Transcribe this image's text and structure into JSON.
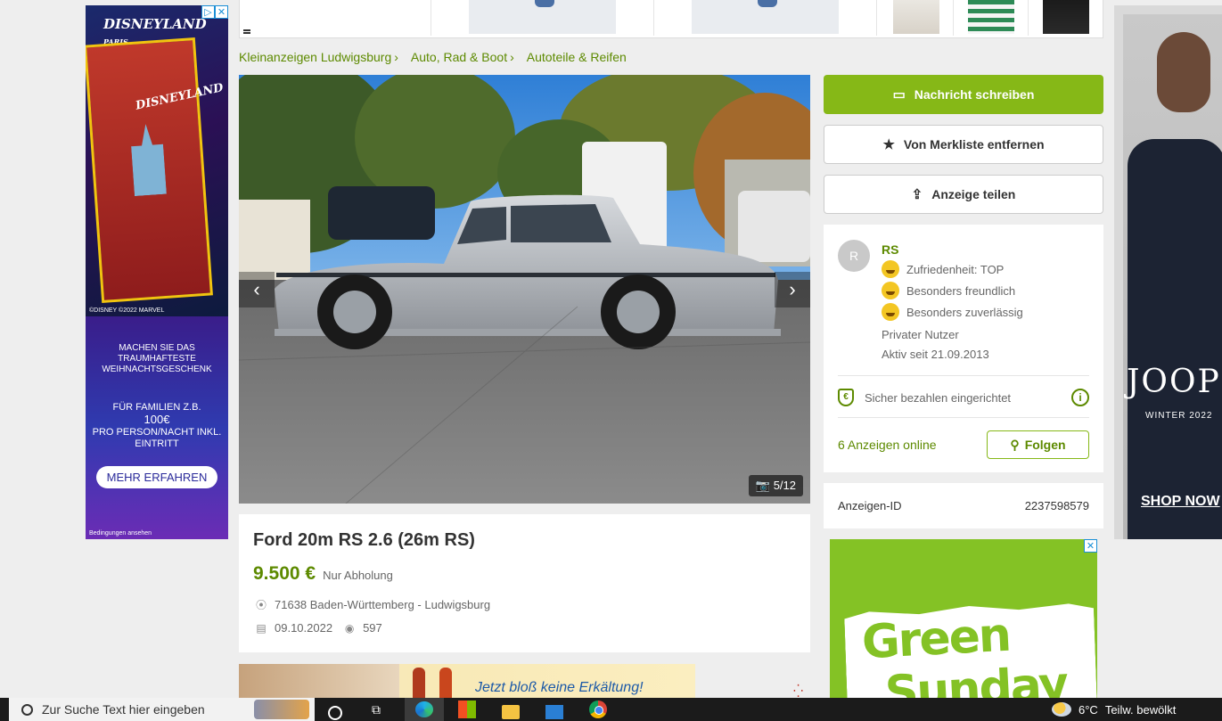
{
  "breadcrumb": [
    {
      "label": "Kleinanzeigen Ludwigsburg"
    },
    {
      "label": "Auto, Rad & Boot"
    },
    {
      "label": "Autoteile & Reifen"
    }
  ],
  "gallery": {
    "counter": "5/12",
    "prev_icon": "chevron-left-icon",
    "next_icon": "chevron-right-icon",
    "camera_icon": "camera-icon"
  },
  "listing": {
    "title": "Ford 20m RS 2.6 (26m RS)",
    "price": "9.500 €",
    "pickup": "Nur Abholung",
    "location": "71638 Baden-Württemberg - Ludwigsburg",
    "date": "09.10.2022",
    "views": "597"
  },
  "actions": {
    "message": "Nachricht schreiben",
    "unwatch": "Von Merkliste entfernen",
    "share": "Anzeige teilen"
  },
  "seller": {
    "avatar_letter": "R",
    "name": "RS",
    "badges": [
      {
        "label": "Zufriedenheit: TOP",
        "icon": "smile-icon"
      },
      {
        "label": "Besonders freundlich",
        "icon": "friendly-icon"
      },
      {
        "label": "Besonders zuverlässig",
        "icon": "reliable-icon"
      }
    ],
    "type": "Privater Nutzer",
    "active_since": "Aktiv seit 21.09.2013",
    "secure_payment": "Sicher bezahlen eingerichtet",
    "ads_online": "6 Anzeigen online",
    "follow": "Folgen"
  },
  "ad_id": {
    "label": "Anzeigen-ID",
    "value": "2237598579"
  },
  "ads": {
    "left": {
      "brand": "DISNEYLAND",
      "brand_sub": "PARIS",
      "copyright": "©DISNEY ©2022 MARVEL",
      "text1": "MACHEN SIE DAS TRAUMHAFTESTE WEIHNACHTSGESCHENK",
      "text2_a": "FÜR FAMILIEN Z.B.",
      "text2_price": "100€",
      "text2_b": "PRO PERSON/NACHT INKL. EINTRITT",
      "cta": "MEHR ERFAHREN",
      "conditions": "Bedingungen ansehen"
    },
    "right": {
      "brand": "JOOP",
      "season": "WINTER 2022",
      "cta": "SHOP NOW"
    },
    "green": {
      "line1": "Green",
      "line2": "Sunday"
    },
    "promo": {
      "text": "Jetzt bloß keine Erkältung!"
    }
  },
  "taskbar": {
    "search_placeholder": "Zur Suche Text hier eingeben",
    "weather_temp": "6°C",
    "weather_desc": "Teilw. bewölkt"
  }
}
